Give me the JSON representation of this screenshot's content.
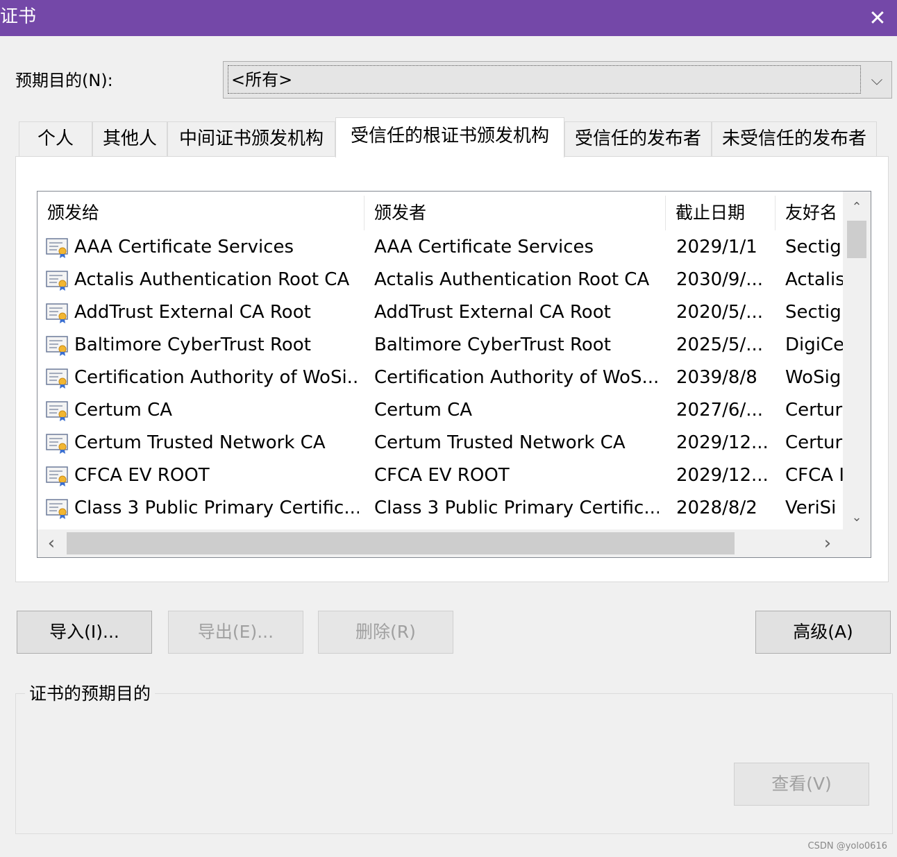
{
  "window": {
    "title": "证书",
    "close_glyph": "✕"
  },
  "purpose": {
    "label": "预期目的(N):",
    "value": "<所有>",
    "arrow_glyph": "⌵"
  },
  "tabs": [
    {
      "label": "个人"
    },
    {
      "label": "其他人"
    },
    {
      "label": "中间证书颁发机构"
    },
    {
      "label": "受信任的根证书颁发机构"
    },
    {
      "label": "受信任的发布者"
    },
    {
      "label": "未受信任的发布者"
    }
  ],
  "active_tab": 3,
  "list": {
    "columns": [
      "颁发给",
      "颁发者",
      "截止日期",
      "友好名"
    ],
    "rows": [
      [
        "AAA Certificate Services",
        "AAA Certificate Services",
        "2029/1/1",
        "Sectig"
      ],
      [
        "Actalis Authentication Root CA",
        "Actalis Authentication Root CA",
        "2030/9/...",
        "Actalis"
      ],
      [
        "AddTrust External CA Root",
        "AddTrust External CA Root",
        "2020/5/...",
        "Sectig"
      ],
      [
        "Baltimore CyberTrust Root",
        "Baltimore CyberTrust Root",
        "2025/5/...",
        "DigiCe"
      ],
      [
        "Certification Authority of WoSi...",
        "Certification Authority of WoS...",
        "2039/8/8",
        "WoSig"
      ],
      [
        "Certum CA",
        "Certum CA",
        "2027/6/...",
        "Certur"
      ],
      [
        "Certum Trusted Network CA",
        "Certum Trusted Network CA",
        "2029/12...",
        "Certur"
      ],
      [
        "CFCA EV ROOT",
        "CFCA EV ROOT",
        "2029/12...",
        "CFCA I"
      ],
      [
        "Class 3 Public Primary Certific...",
        "Class 3 Public Primary Certific...",
        "2028/8/2",
        "VeriSi"
      ]
    ],
    "icons": {
      "row": "certificate-icon"
    },
    "scroll": {
      "up": "⌃",
      "down": "⌄",
      "left": "‹",
      "right": "›"
    }
  },
  "buttons": {
    "import": "导入(I)...",
    "export": "导出(E)...",
    "remove": "删除(R)",
    "advanced": "高级(A)",
    "view": "查看(V)"
  },
  "group": {
    "label": "证书的预期目的"
  },
  "watermark": "CSDN @yolo0616",
  "colors": {
    "titlebar": "#7448a8",
    "background": "#f0f0f0"
  }
}
